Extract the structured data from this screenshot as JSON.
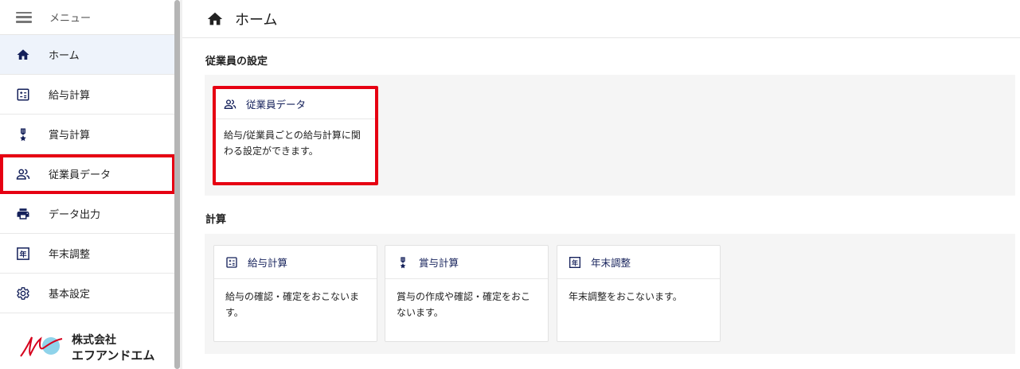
{
  "sidebar": {
    "menu_label": "メニュー",
    "items": [
      {
        "label": "ホーム",
        "icon": "home-icon"
      },
      {
        "label": "給与計算",
        "icon": "calculator-icon"
      },
      {
        "label": "賞与計算",
        "icon": "medal-icon"
      },
      {
        "label": "従業員データ",
        "icon": "people-icon"
      },
      {
        "label": "データ出力",
        "icon": "printer-icon"
      },
      {
        "label": "年末調整",
        "icon": "year-icon"
      },
      {
        "label": "基本設定",
        "icon": "gear-icon"
      }
    ],
    "logo": {
      "line1": "株式会社",
      "line2": "エフアンドエム"
    }
  },
  "header": {
    "title": "ホーム",
    "icon": "home-icon"
  },
  "sections": [
    {
      "title": "従業員の設定",
      "cards": [
        {
          "title": "従業員データ",
          "icon": "people-icon",
          "description": "給与/従業員ごとの給与計算に関わる設定ができます。"
        }
      ]
    },
    {
      "title": "計算",
      "cards": [
        {
          "title": "給与計算",
          "icon": "calculator-icon",
          "description": "給与の確認・確定をおこないます。"
        },
        {
          "title": "賞与計算",
          "icon": "medal-icon",
          "description": "賞与の作成や確認・確定をおこないます。"
        },
        {
          "title": "年末調整",
          "icon": "year-icon",
          "description": "年末調整をおこないます。"
        }
      ]
    }
  ],
  "colors": {
    "highlight": "#e60012",
    "icon_navy": "#14205a",
    "active_bg": "#eef3fb",
    "section_bg": "#f5f5f5"
  }
}
